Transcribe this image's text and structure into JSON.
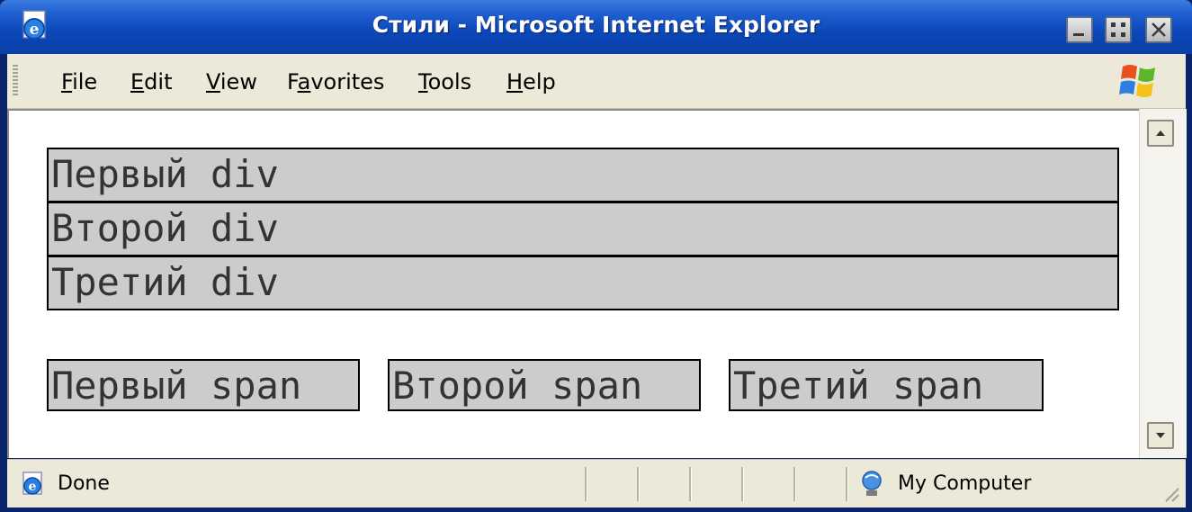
{
  "window": {
    "title": "Стили - Microsoft Internet Explorer"
  },
  "menu": {
    "items": [
      {
        "accel": "F",
        "rest": "ile"
      },
      {
        "accel": "E",
        "rest": "dit"
      },
      {
        "accel": "V",
        "rest": "iew"
      },
      {
        "pre": "F",
        "accel": "a",
        "rest": "vorites"
      },
      {
        "accel": "T",
        "rest": "ools"
      },
      {
        "accel": "H",
        "rest": "elp"
      }
    ]
  },
  "content": {
    "divs": [
      "Первый div",
      "Второй div",
      "Третий div"
    ],
    "spans": [
      "Первый span",
      "Второй span",
      "Третий span"
    ],
    "box_background": "#cccccc",
    "box_border": "#000000"
  },
  "status": {
    "text": "Done",
    "zone": "My Computer"
  },
  "icons": {
    "title": "ie-page-icon",
    "menu_logo": "windows-xp-logo",
    "status": "ie-page-icon",
    "zone": "my-computer-icon"
  },
  "colors": {
    "titlebar": "#0b47b8",
    "chrome": "#ece9d8"
  }
}
